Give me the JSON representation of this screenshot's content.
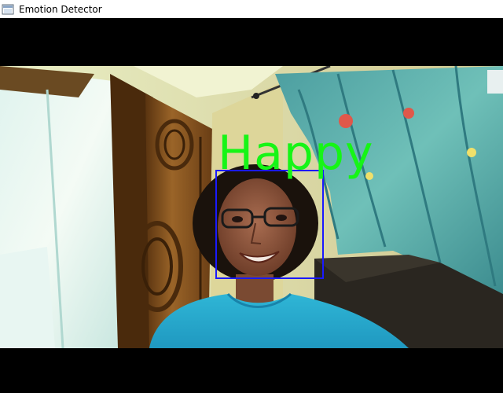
{
  "window": {
    "title": "Emotion Detector",
    "icon": "window-app-icon"
  },
  "detection": {
    "emotion_label": "Happy",
    "label_color": "#16f516",
    "box_color": "#1a1aff"
  }
}
